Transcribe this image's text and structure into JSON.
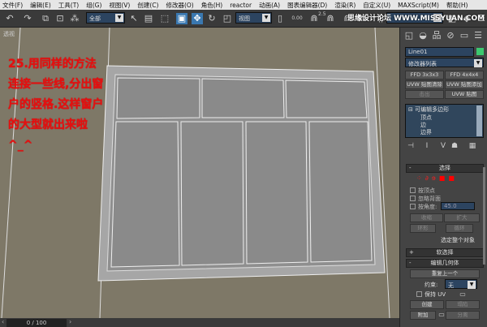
{
  "menu": [
    "文件(F)",
    "编辑(E)",
    "工具(T)",
    "组(G)",
    "视图(V)",
    "创建(C)",
    "修改器(O)",
    "角色(H)",
    "reactor",
    "动画(A)",
    "图表编辑器(D)",
    "渲染(R)",
    "自定义(U)",
    "MAXScript(M)",
    "帮助(H)"
  ],
  "toolbar": {
    "selection_filter": "全部",
    "ref_coord": "视图",
    "snap_value": "2.5",
    "spinner_snap": "0.00"
  },
  "watermark": "思缘设计论坛 WWW.MISSYUAN.COM",
  "viewport": {
    "label": "透视",
    "note": "25.用同样的方法连接一些线,分出窗户的竖格.这样窗户的大型就出来啦^_^"
  },
  "panel": {
    "object_name": "Line01",
    "object_color": "#3cc870",
    "modifier_list": "修改器列表",
    "mod_buttons": [
      "FFD 3x3x3",
      "FFD 4x4x4",
      "UVW 贴图清除",
      "UVW 贴图添加",
      "击出",
      "UVW 贴图"
    ],
    "stack": {
      "root": "可编辑多边形",
      "items": [
        "顶点",
        "边",
        "边界"
      ]
    },
    "selection": {
      "title": "选择",
      "checks": [
        "按顶点",
        "忽略背面",
        "按角度:"
      ],
      "angle": "45.0",
      "shrink": "收缩",
      "grow": "扩大",
      "ring": "环形",
      "loop": "循环",
      "status": "选定整个对象"
    },
    "soft_selection": "软选择",
    "edit_geometry": {
      "title": "编辑几何体",
      "repeat_last": "重复上一个",
      "constraint_label": "约束:",
      "constraint_value": "无",
      "preserve_uv": "保持 UV",
      "create": "创建",
      "collapse": "塌陷",
      "attach": "附加",
      "detach": "分离"
    }
  },
  "timeline": {
    "frame": "0 / 100"
  }
}
